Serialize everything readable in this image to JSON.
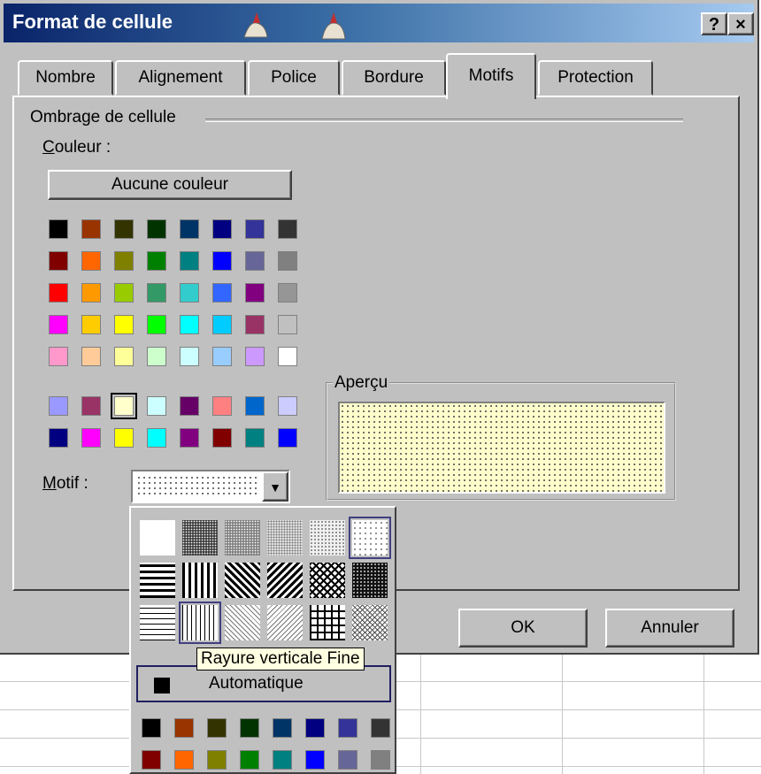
{
  "dialog": {
    "title": "Format de cellule",
    "help_button": "?",
    "close_button": "×"
  },
  "tabs": [
    {
      "label": "Nombre",
      "active": false
    },
    {
      "label": "Alignement",
      "active": false
    },
    {
      "label": "Police",
      "active": false
    },
    {
      "label": "Bordure",
      "active": false
    },
    {
      "label": "Motifs",
      "active": true
    },
    {
      "label": "Protection",
      "active": false
    }
  ],
  "shading": {
    "group_label": "Ombrage de cellule",
    "color_label": "Couleur :",
    "no_color_button": "Aucune couleur",
    "palette_main": [
      [
        "#000000",
        "#993300",
        "#333300",
        "#003300",
        "#003366",
        "#000080",
        "#333399",
        "#333333"
      ],
      [
        "#800000",
        "#ff6600",
        "#808000",
        "#008000",
        "#008080",
        "#0000ff",
        "#666699",
        "#808080"
      ],
      [
        "#ff0000",
        "#ff9900",
        "#99cc00",
        "#339966",
        "#33cccc",
        "#3366ff",
        "#800080",
        "#969696"
      ],
      [
        "#ff00ff",
        "#ffcc00",
        "#ffff00",
        "#00ff00",
        "#00ffff",
        "#00ccff",
        "#993366",
        "#c0c0c0"
      ],
      [
        "#ff99cc",
        "#ffcc99",
        "#ffff99",
        "#ccffcc",
        "#ccffff",
        "#99ccff",
        "#cc99ff",
        "#ffffff"
      ]
    ],
    "palette_extra": [
      [
        "#9999ff",
        "#993366",
        "#ffffcc",
        "#ccffff",
        "#660066",
        "#ff8080",
        "#0066cc",
        "#ccccff"
      ],
      [
        "#000080",
        "#ff00ff",
        "#ffff00",
        "#00ffff",
        "#800080",
        "#800000",
        "#008080",
        "#0000ff"
      ]
    ],
    "selected_color": "#ffffcc"
  },
  "preview": {
    "label": "Aperçu"
  },
  "motif": {
    "label": "Motif :",
    "dropdown_arrow": "▼"
  },
  "buttons": {
    "ok": "OK",
    "cancel": "Annuler"
  },
  "pattern_popup": {
    "patterns": [
      [
        "solid",
        "dark-gray",
        "medium-gray",
        "light-gray-75",
        "gray-25",
        "gray-12-5"
      ],
      [
        "thick-horizontal",
        "thick-vertical",
        "thick-reverse-diagonal",
        "thick-diagonal",
        "thick-diagonal-crosshatch",
        "thick-crosshatch"
      ],
      [
        "thin-horizontal",
        "thin-vertical",
        "thin-reverse-diagonal",
        "thin-diagonal",
        "thin-horizontal-crosshatch",
        "thin-diagonal-crosshatch"
      ]
    ],
    "tooltip": "Rayure verticale Fine",
    "automatic_label": "Automatique",
    "palette": [
      [
        "#000000",
        "#993300",
        "#333300",
        "#003300",
        "#003366",
        "#000080",
        "#333399",
        "#333333"
      ],
      [
        "#800000",
        "#ff6600",
        "#808000",
        "#008000",
        "#008080",
        "#0000ff",
        "#666699",
        "#808080"
      ]
    ]
  }
}
